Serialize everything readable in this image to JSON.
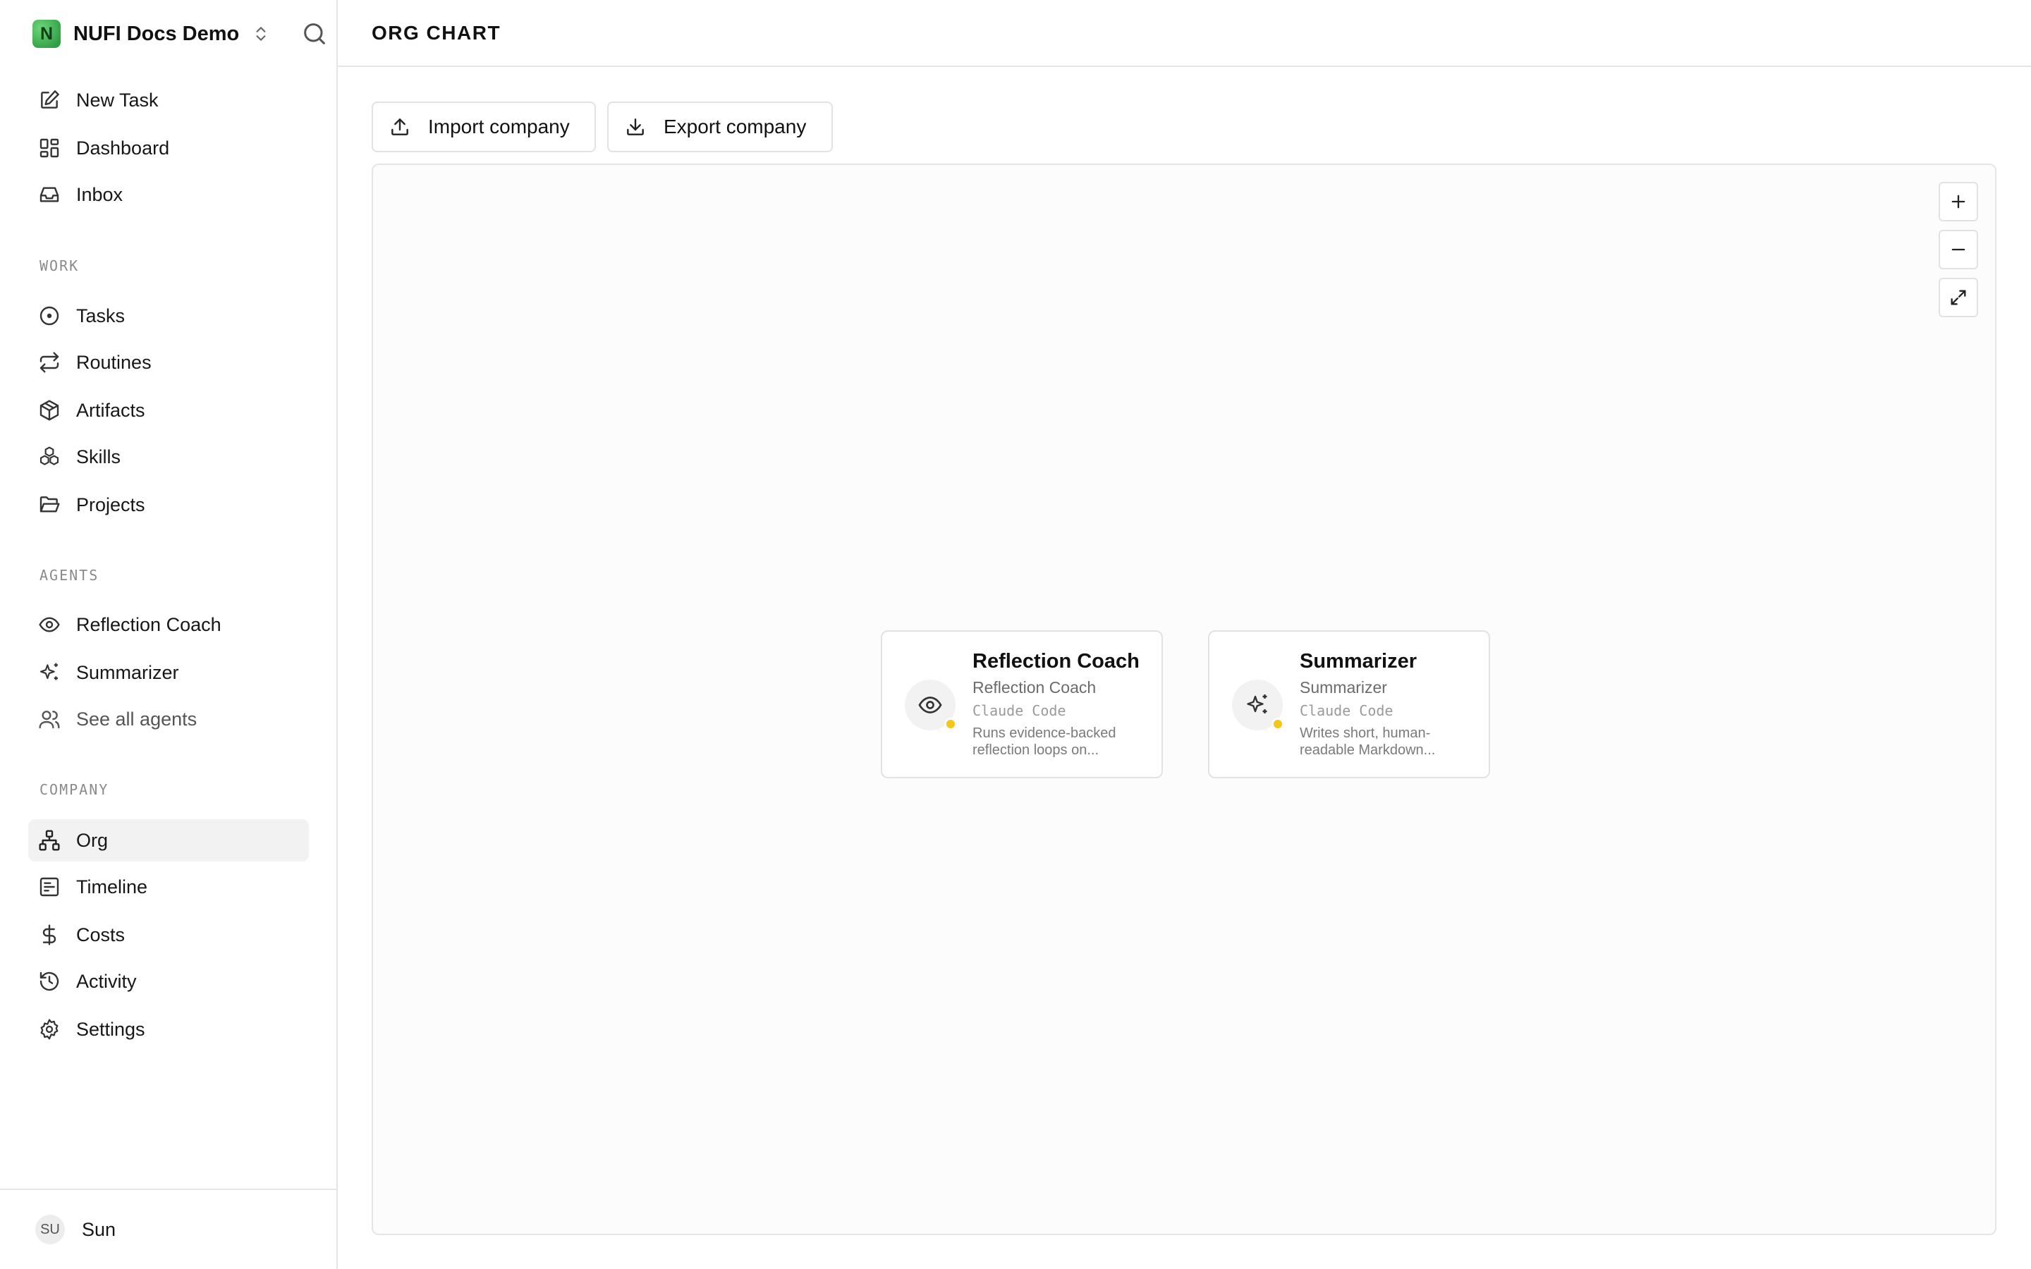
{
  "workspace": {
    "logo_letter": "N",
    "name": "NUFI Docs Demo"
  },
  "nav": {
    "main": [
      {
        "label": "New Task",
        "icon": "pencil-square-icon"
      },
      {
        "label": "Dashboard",
        "icon": "dashboard-icon"
      },
      {
        "label": "Inbox",
        "icon": "inbox-icon"
      }
    ],
    "work_label": "WORK",
    "work": [
      {
        "label": "Tasks",
        "icon": "circle-dot-icon"
      },
      {
        "label": "Routines",
        "icon": "repeat-icon"
      },
      {
        "label": "Artifacts",
        "icon": "box-icon"
      },
      {
        "label": "Skills",
        "icon": "boxes-icon"
      },
      {
        "label": "Projects",
        "icon": "folder-open-icon"
      }
    ],
    "agents_label": "AGENTS",
    "agents": [
      {
        "label": "Reflection Coach",
        "icon": "eye-icon"
      },
      {
        "label": "Summarizer",
        "icon": "sparkles-icon"
      },
      {
        "label": "See all agents",
        "icon": "users-icon"
      }
    ],
    "company_label": "COMPANY",
    "company": [
      {
        "label": "Org",
        "icon": "org-chart-icon",
        "active": true
      },
      {
        "label": "Timeline",
        "icon": "timeline-icon"
      },
      {
        "label": "Costs",
        "icon": "dollar-icon"
      },
      {
        "label": "Activity",
        "icon": "history-icon"
      },
      {
        "label": "Settings",
        "icon": "gear-icon"
      }
    ]
  },
  "user": {
    "initials": "SU",
    "name": "Sun"
  },
  "page": {
    "title": "ORG CHART"
  },
  "toolbar": {
    "import_label": "Import company",
    "export_label": "Export company"
  },
  "zoom": {
    "in_label": "+",
    "out_label": "−"
  },
  "agents": [
    {
      "name": "Reflection Coach",
      "role": "Reflection Coach",
      "adapter": "Claude Code",
      "description": "Runs evidence-backed reflection loops on...",
      "icon": "eye-icon",
      "status_color": "#f5c518"
    },
    {
      "name": "Summarizer",
      "role": "Summarizer",
      "adapter": "Claude Code",
      "description": "Writes short, human-readable Markdown...",
      "icon": "sparkles-icon",
      "status_color": "#f5c518"
    }
  ],
  "colors": {
    "brand": "#3fb950",
    "status_idle": "#f5c518",
    "border": "#e5e5e5"
  }
}
